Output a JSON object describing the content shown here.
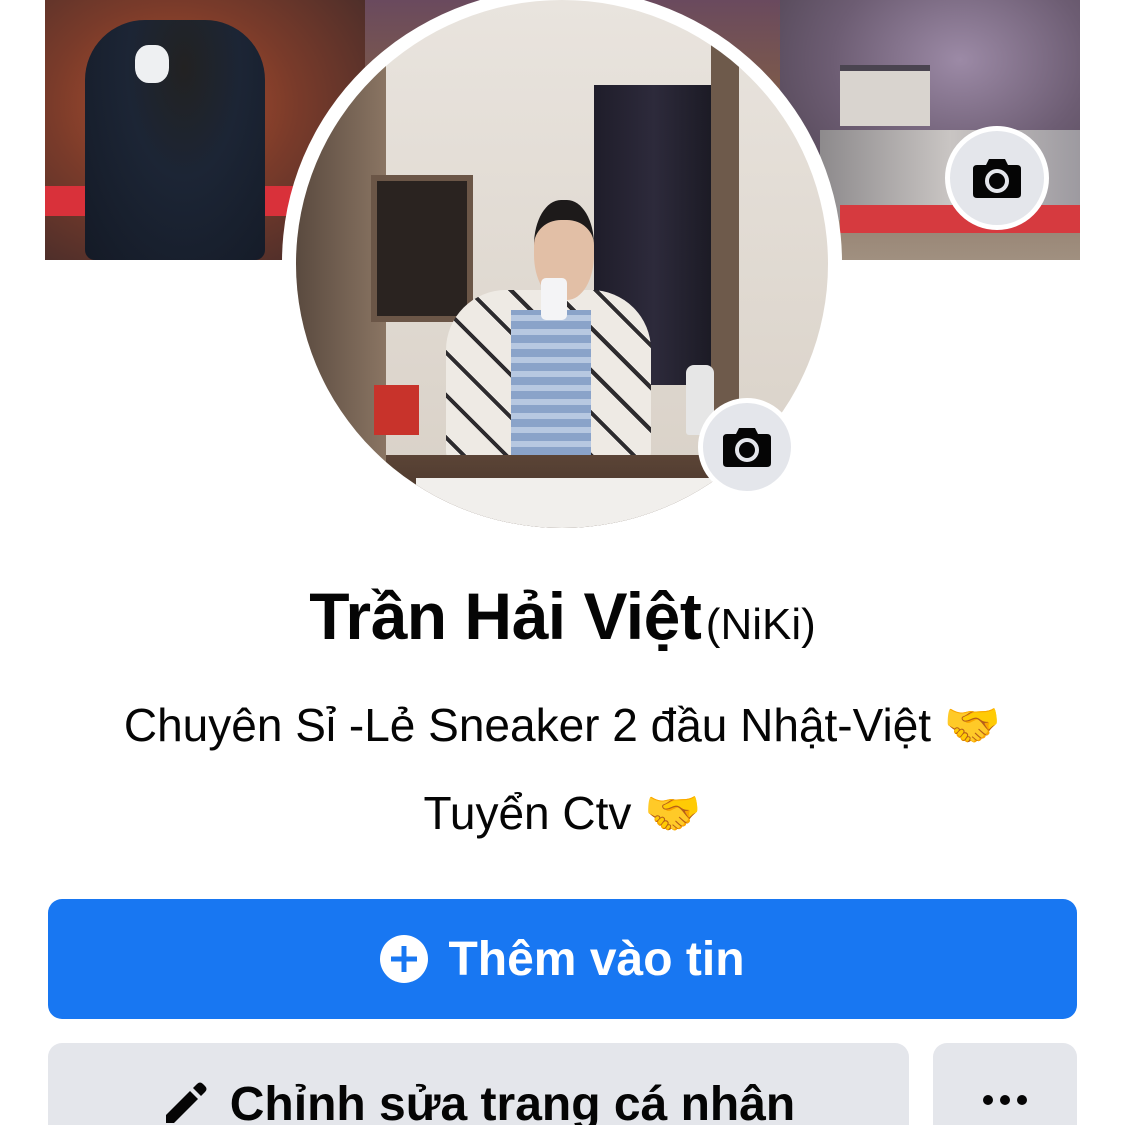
{
  "profile": {
    "name": "Trần Hải Việt",
    "alternate_name": "(NiKi)",
    "bio_line1": "Chuyên Sỉ -Lẻ Sneaker 2 đầu Nhật-Việt 🤝",
    "bio_line2": "Tuyển Ctv 🤝"
  },
  "actions": {
    "add_to_story_label": "Thêm vào tin",
    "edit_profile_label": "Chỉnh sửa trang cá nhân"
  },
  "icons": {
    "cover_camera": "camera-icon",
    "avatar_camera": "camera-icon",
    "add": "plus-circle-icon",
    "edit": "pencil-icon",
    "more": "more-horizontal-icon"
  },
  "colors": {
    "primary": "#1877f2",
    "secondary_bg": "#e4e6eb",
    "text": "#050505"
  }
}
